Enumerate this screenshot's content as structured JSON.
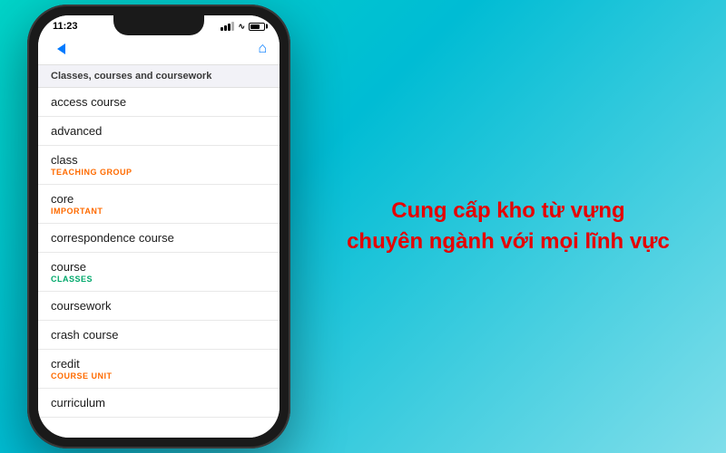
{
  "background": {
    "gradient_start": "#00d4c8",
    "gradient_end": "#80deea"
  },
  "phone": {
    "status_bar": {
      "time": "11:23",
      "battery_indicator": "battery"
    },
    "nav": {
      "back_label": "back",
      "home_label": "home"
    },
    "section_header": "Classes, courses and coursework",
    "list_items": [
      {
        "id": 1,
        "main": "access course",
        "sub": null,
        "sub_color": null
      },
      {
        "id": 2,
        "main": "advanced",
        "sub": null,
        "sub_color": null
      },
      {
        "id": 3,
        "main": "class",
        "sub": "TEACHING GROUP",
        "sub_color": "orange"
      },
      {
        "id": 4,
        "main": "core",
        "sub": "IMPORTANT",
        "sub_color": "orange"
      },
      {
        "id": 5,
        "main": "correspondence course",
        "sub": null,
        "sub_color": null
      },
      {
        "id": 6,
        "main": "course",
        "sub": "CLASSES",
        "sub_color": "green"
      },
      {
        "id": 7,
        "main": "coursework",
        "sub": null,
        "sub_color": null
      },
      {
        "id": 8,
        "main": "crash course",
        "sub": null,
        "sub_color": null
      },
      {
        "id": 9,
        "main": "credit",
        "sub": "COURSE UNIT",
        "sub_color": "orange"
      },
      {
        "id": 10,
        "main": "curriculum",
        "sub": null,
        "sub_color": null
      }
    ]
  },
  "tagline": {
    "line1": "Cung cấp kho từ vựng",
    "line2": "chuyên ngành với mọi lĩnh vực",
    "color": "#e60000"
  }
}
